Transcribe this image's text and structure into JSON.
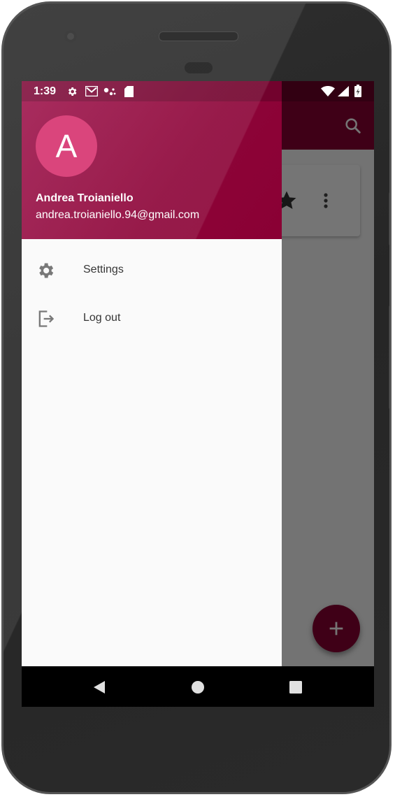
{
  "status_bar": {
    "time": "1:39",
    "icons": [
      "settings-icon",
      "gmail-icon",
      "assistant-dots-icon",
      "sd-card-icon",
      "wifi-icon",
      "cell-signal-icon",
      "battery-charging-icon"
    ]
  },
  "drawer": {
    "avatar_letter": "A",
    "user_name": "Andrea Troianiello",
    "user_email": "andrea.troianiello.94@gmail.com",
    "items": [
      {
        "label": "Settings",
        "icon": "gear-icon"
      },
      {
        "label": "Log out",
        "icon": "logout-icon"
      }
    ]
  },
  "app": {
    "fab_icon": "plus-icon",
    "action_icon": "search-icon"
  },
  "colors": {
    "primary": "#8a0034",
    "avatar": "#d6336f",
    "drawer_background": "#fafafa"
  }
}
